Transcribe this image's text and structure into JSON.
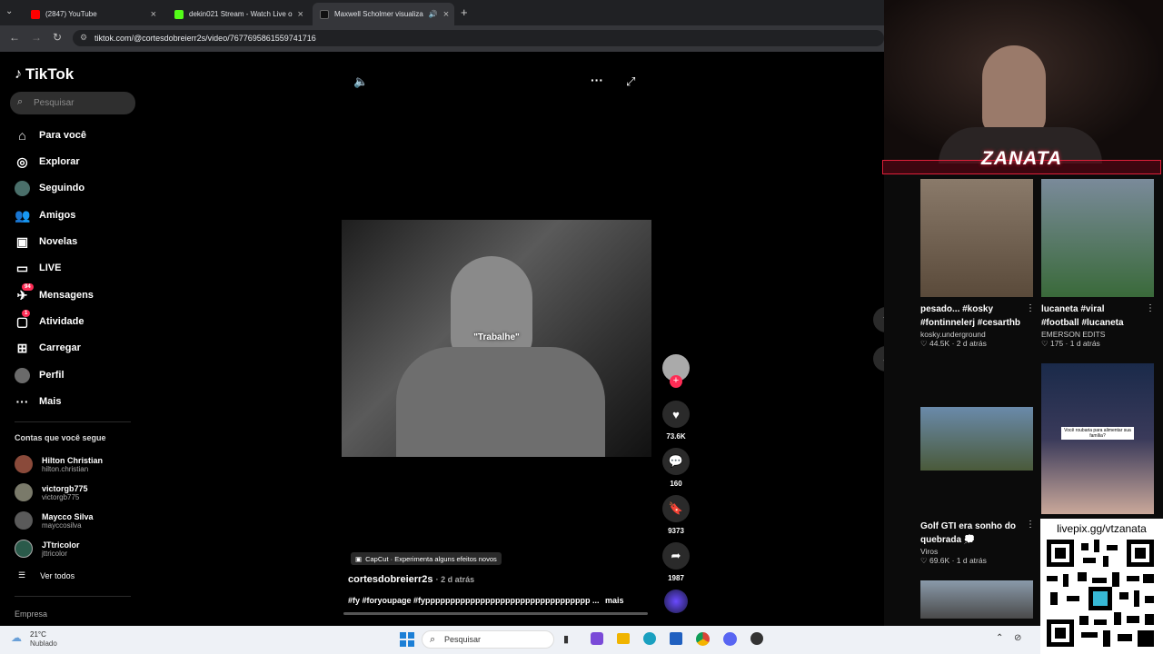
{
  "browser": {
    "tabs": [
      {
        "title": "(2847) YouTube",
        "color": "#ff0000"
      },
      {
        "title": "dekin021 Stream - Watch Live o",
        "color": "#53fc18"
      },
      {
        "title": "Maxwell Scholmer visualiza",
        "color": "#111111"
      }
    ],
    "url": "tiktok.com/@cortesdobreierr2s/video/7677695861559741716"
  },
  "sidebar": {
    "logo": "TikTok",
    "search_placeholder": "Pesquisar",
    "nav": [
      {
        "label": "Para você",
        "icon": "home-icon"
      },
      {
        "label": "Explorar",
        "icon": "compass-icon"
      },
      {
        "label": "Seguindo",
        "icon": "following-icon"
      },
      {
        "label": "Amigos",
        "icon": "friends-icon"
      },
      {
        "label": "Novelas",
        "icon": "novelas-icon"
      },
      {
        "label": "LIVE",
        "icon": "live-icon"
      },
      {
        "label": "Mensagens",
        "icon": "messages-icon",
        "badge": "94"
      },
      {
        "label": "Atividade",
        "icon": "activity-icon",
        "badge": "1"
      },
      {
        "label": "Carregar",
        "icon": "upload-icon"
      },
      {
        "label": "Perfil",
        "icon": "profile-icon"
      },
      {
        "label": "Mais",
        "icon": "more-icon"
      }
    ],
    "following_title": "Contas que você segue",
    "accounts": [
      {
        "name": "Hilton Christian",
        "handle": "hilton.christian"
      },
      {
        "name": "victorgb775",
        "handle": "victorgb775"
      },
      {
        "name": "Maycco Silva",
        "handle": "mayccosilva"
      },
      {
        "name": "JTtricolor",
        "handle": "jttricolor"
      }
    ],
    "see_all": "Ver todos",
    "footer": "Empresa"
  },
  "video": {
    "caption_overlay": "\"Trabalhe\"",
    "capcut_label": "CapCut · Experimenta alguns efeitos novos",
    "author": "cortesdobreierr2s",
    "posted": "· 2 d atrás",
    "hashtags": "#fy #foryoupage #fyppppppppppppppppppppppppppppppppp ...",
    "more": "mais",
    "likes": "73.6K",
    "comments": "160",
    "saves": "9373",
    "shares": "1987"
  },
  "stream_overlay": {
    "brand": "ZANATA",
    "livepix": "livepix.gg/vtzanata"
  },
  "recommended": [
    {
      "title": "pesado... #kosky #fontinnelerj #cesarthb",
      "author": "kosky.underground",
      "likes": "44.5K",
      "age": "2 d atrás"
    },
    {
      "title": "lucaneta #viral #football #lucaneta",
      "author": "EMERSON EDITS",
      "likes": "175",
      "age": "1 d atrás"
    },
    {
      "title": "Golf GTI era sonho do quebrada 💭",
      "author": "Viros",
      "likes": "69.6K",
      "age": "1 d atrás"
    },
    {
      "thumb_caption": "Você roubaria para alimentar sua família?"
    }
  ],
  "taskbar": {
    "temp": "21°C",
    "weather": "Nublado",
    "search": "Pesquisar"
  }
}
